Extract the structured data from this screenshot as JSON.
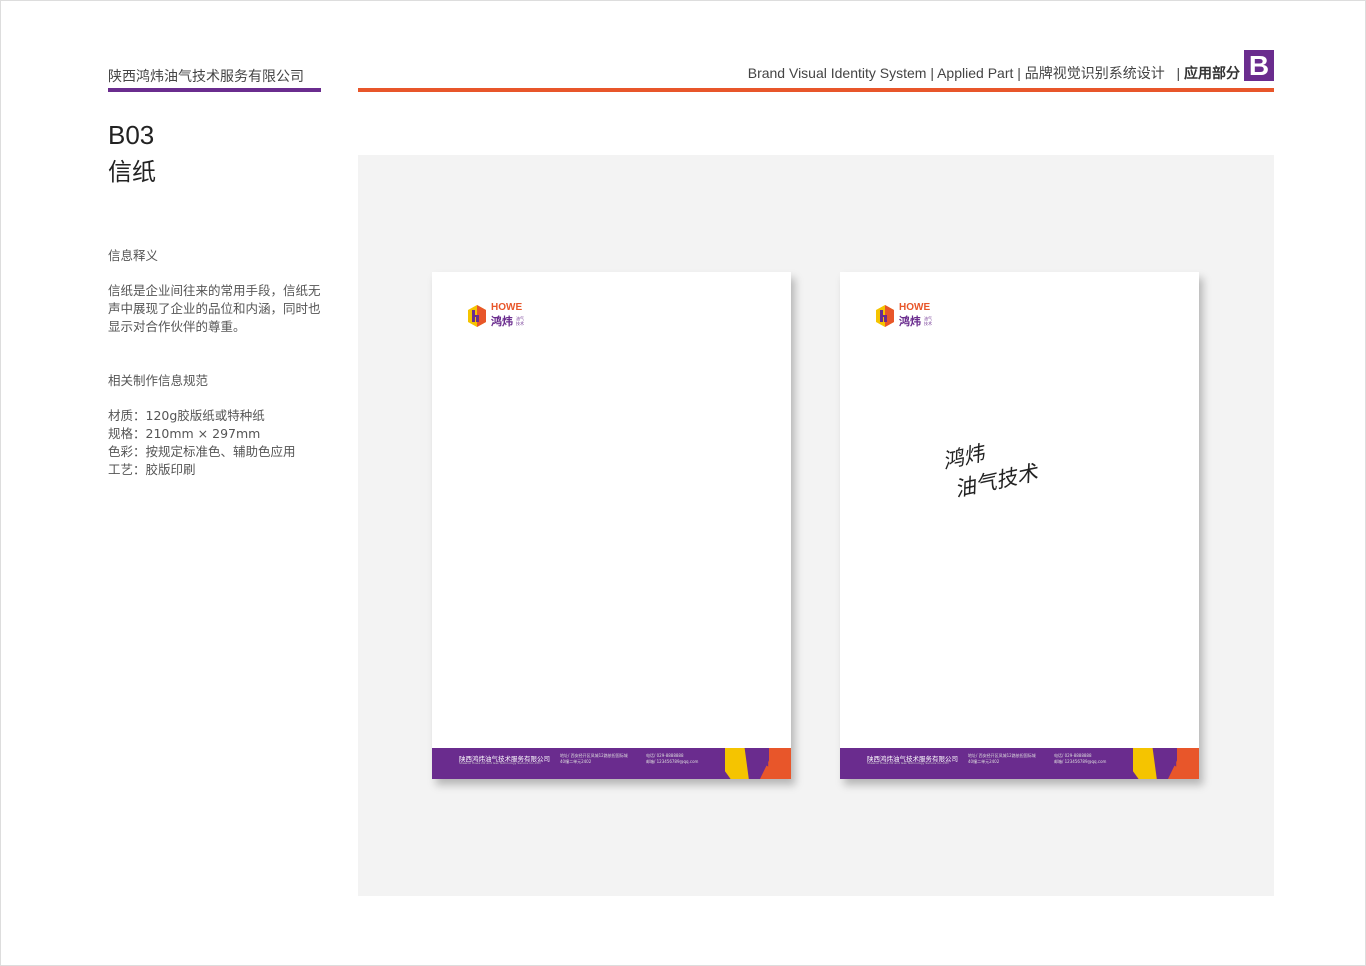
{
  "header": {
    "company": "陕西鸿炜油气技术服务有限公司",
    "title_en": "Brand Visual Identity System | Applied Part",
    "divider": "|",
    "title_cn": "品牌视觉识别系统设计",
    "section": "应用部分",
    "badge": "B"
  },
  "page": {
    "code": "B03",
    "title": "信纸"
  },
  "info": {
    "heading": "信息释义",
    "body": "信纸是企业间往来的常用手段，信纸无声中展现了企业的品位和内涵，同时也显示对合作伙伴的尊重。"
  },
  "spec": {
    "heading": "相关制作信息规范",
    "lines": [
      "材质：120g胶版纸或特种纸",
      "规格：210mm × 297mm",
      "色彩：按规定标准色、辅助色应用",
      "工艺：胶版印刷"
    ]
  },
  "letterhead": {
    "logo": {
      "en": "HOWE",
      "cn": "鸿炜",
      "sub1": "油气",
      "sub2": "技术"
    },
    "footer": {
      "name": "陕西鸿炜油气技术服务有限公司",
      "name_en": "Shaanxi Howe Oil and Gas Technology Service Co.,LTD",
      "addr1": "地址/ 西安经开区凤城12路依担国际城",
      "addr2": "40幢二单元2402",
      "phone": "电话/ 029-8888888",
      "email": "邮箱/ 123456789@qq.com"
    },
    "handwriting": {
      "line1": "鸿炜",
      "line2": "油气技术"
    }
  },
  "colors": {
    "purple": "#6a2c8e",
    "orange": "#e8562a",
    "yellow": "#f5c400"
  }
}
